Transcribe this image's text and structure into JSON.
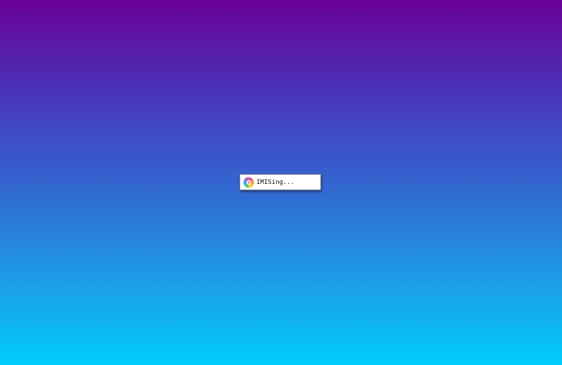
{
  "desktop": {
    "background": {
      "top_color": "#6a0099",
      "bottom_color": "#00cdfa"
    }
  },
  "splash": {
    "icon": "imising-logo-icon",
    "text": "IMISing..."
  }
}
